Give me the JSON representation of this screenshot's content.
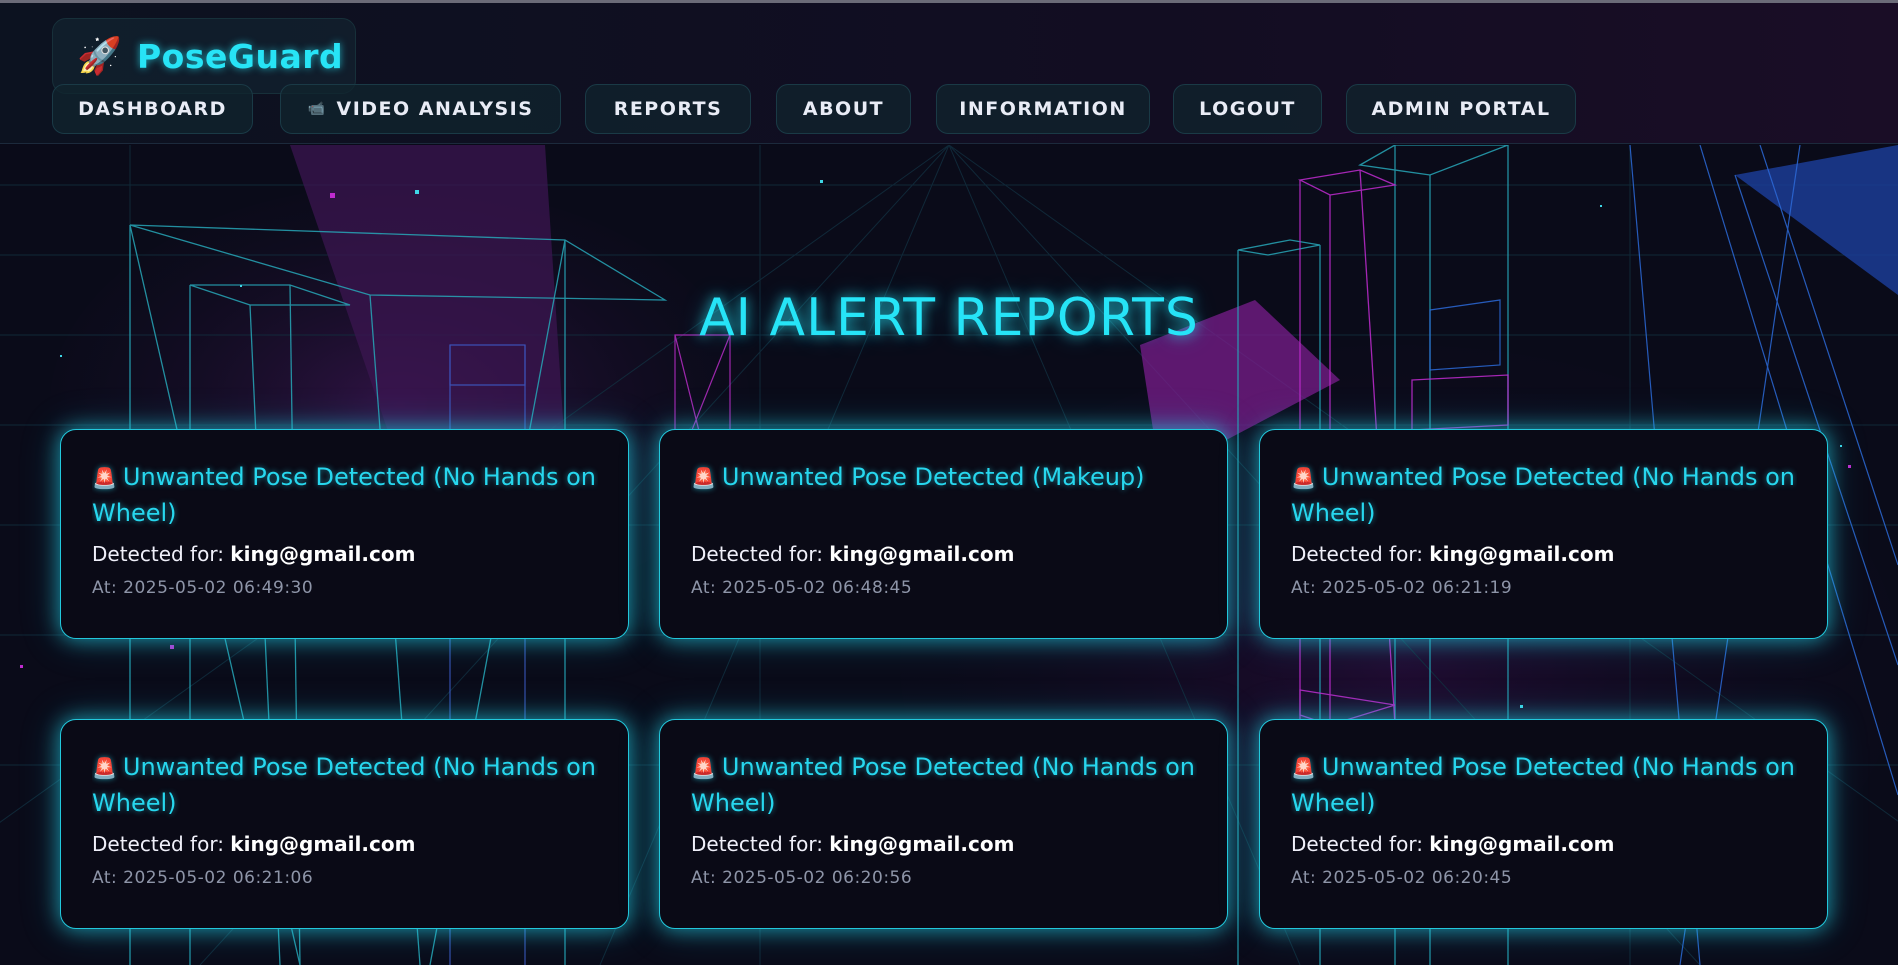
{
  "app": {
    "brand_icon": "rocket-icon",
    "brand_icon_glyph": "🚀",
    "brand_name": "PoseGuard"
  },
  "nav": [
    {
      "label": "DASHBOARD",
      "icon": ""
    },
    {
      "label": "VIDEO ANALYSIS",
      "icon": "video-camera-icon",
      "icon_glyph": "📹"
    },
    {
      "label": "REPORTS",
      "icon": ""
    },
    {
      "label": "ABOUT",
      "icon": ""
    },
    {
      "label": "INFORMATION",
      "icon": ""
    },
    {
      "label": "LOGOUT",
      "icon": ""
    },
    {
      "label": "ADMIN PORTAL",
      "icon": ""
    }
  ],
  "page": {
    "title": "AI ALERT REPORTS"
  },
  "alerts": [
    {
      "icon": "siren-icon",
      "title": "Unwanted Pose Detected (No Hands on Wheel)",
      "detected_label": "Detected for:",
      "email": "king@gmail.com",
      "timestamp": "At: 2025-05-02 06:49:30"
    },
    {
      "icon": "siren-icon",
      "title": "Unwanted Pose Detected (Makeup)",
      "detected_label": "Detected for:",
      "email": "king@gmail.com",
      "timestamp": "At: 2025-05-02 06:48:45"
    },
    {
      "icon": "siren-icon",
      "title": "Unwanted Pose Detected (No Hands on Wheel)",
      "detected_label": "Detected for:",
      "email": "king@gmail.com",
      "timestamp": "At: 2025-05-02 06:21:19"
    },
    {
      "icon": "siren-icon",
      "title": "Unwanted Pose Detected (No Hands on Wheel)",
      "detected_label": "Detected for:",
      "email": "king@gmail.com",
      "timestamp": "At: 2025-05-02 06:21:06"
    },
    {
      "icon": "siren-icon",
      "title": "Unwanted Pose Detected (No Hands on Wheel)",
      "detected_label": "Detected for:",
      "email": "king@gmail.com",
      "timestamp": "At: 2025-05-02 06:20:56"
    },
    {
      "icon": "siren-icon",
      "title": "Unwanted Pose Detected (No Hands on Wheel)",
      "detected_label": "Detected for:",
      "email": "king@gmail.com",
      "timestamp": "At: 2025-05-02 06:20:45"
    }
  ],
  "colors": {
    "accent": "#26e4f7",
    "background": "#0a0a18",
    "magenta": "#c02bd0",
    "card_border": "#22c8dc"
  }
}
